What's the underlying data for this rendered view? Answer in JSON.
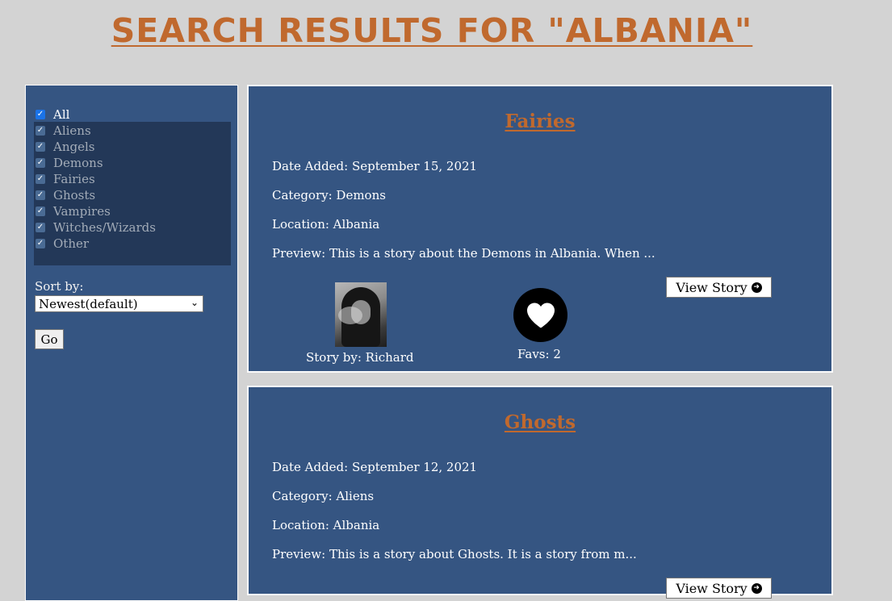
{
  "page": {
    "title": "Search Results for \"Albania\""
  },
  "sidebar": {
    "filter_all": "All",
    "filters": [
      "Aliens",
      "Angels",
      "Demons",
      "Fairies",
      "Ghosts",
      "Vampires",
      "Witches/Wizards",
      "Other"
    ],
    "sort_label": "Sort by:",
    "sort_selected": "Newest(default)",
    "go_label": "Go"
  },
  "stories": [
    {
      "title": "Fairies",
      "date": "Date Added: September 15, 2021",
      "category": "Category: Demons",
      "location": "Location: Albania",
      "preview": "Preview: This is a story about the Demons in Albania. When ...",
      "view_label": "View Story",
      "author": "Story by: Richard",
      "favs": "Favs: 2"
    },
    {
      "title": "Ghosts",
      "date": "Date Added: September 12, 2021",
      "category": "Category: Aliens",
      "location": "Location: Albania",
      "preview": "Preview: This is a story about Ghosts. It is a story from m...",
      "view_label": "View Story"
    }
  ],
  "colors": {
    "background": "#d3d3d3",
    "panel": "#355582",
    "accent": "#c0692e"
  },
  "icons": {
    "heart": "heart-icon",
    "view_arrow": "arrow-right-circle-icon",
    "select_chevron": "chevron-down-icon"
  }
}
